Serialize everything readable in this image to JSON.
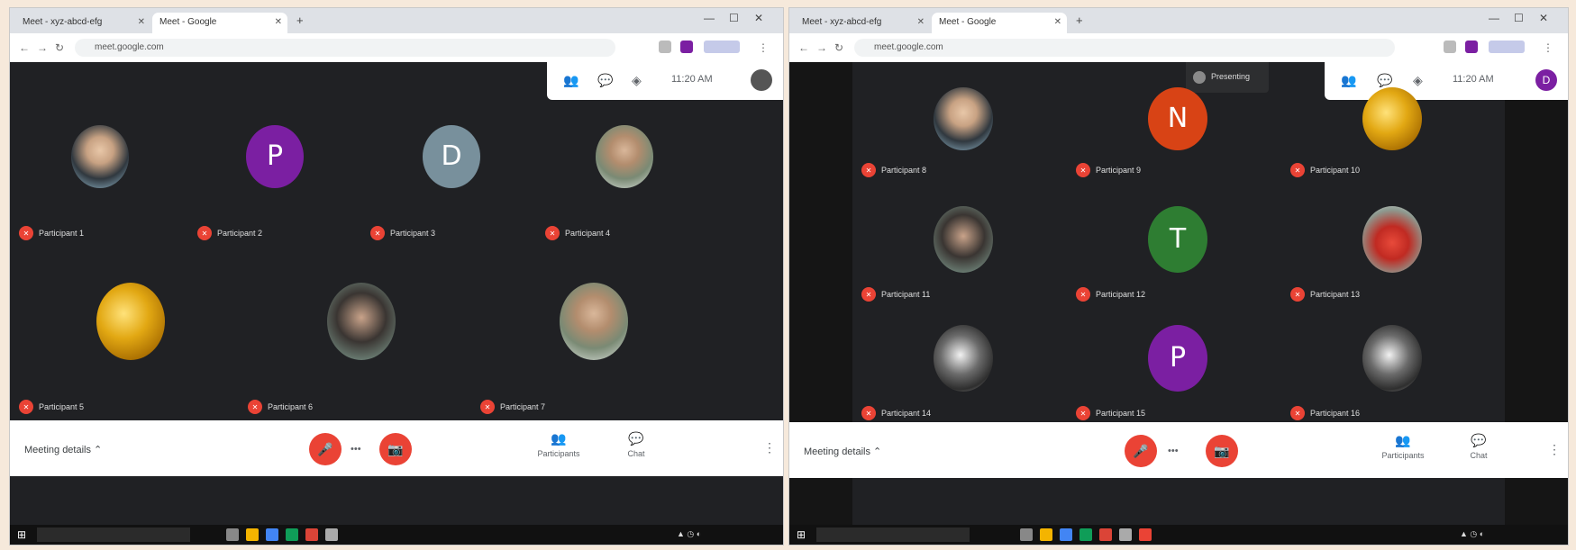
{
  "left": {
    "tabs": [
      {
        "label": "Meet - xyz-abcd-efg"
      },
      {
        "label": "Meet - Google"
      }
    ],
    "url": "meet.google.com",
    "time": "11:20 AM",
    "me_initial": "",
    "tiles": [
      {
        "initial": "",
        "name": "Participant 1"
      },
      {
        "initial": "P",
        "name": "Participant 2"
      },
      {
        "initial": "D",
        "name": "Participant 3"
      },
      {
        "initial": "",
        "name": "Participant 4"
      },
      {
        "initial": "",
        "name": "Participant 5"
      },
      {
        "initial": "",
        "name": "Participant 6"
      },
      {
        "initial": "",
        "name": "Participant 7"
      }
    ],
    "meeting_name": "Meeting details",
    "bottom_buttons": [
      {
        "label": "Participants",
        "icon": "people-icon"
      },
      {
        "label": "Chat",
        "icon": "chat-icon"
      }
    ]
  },
  "right": {
    "tabs": [
      {
        "label": "Meet - xyz-abcd-efg"
      },
      {
        "label": "Meet - Google"
      }
    ],
    "url": "meet.google.com",
    "time": "11:20 AM",
    "me_initial": "D",
    "presenting_label": "Presenting",
    "tiles": [
      {
        "initial": "",
        "name": "Participant 8"
      },
      {
        "initial": "N",
        "name": "Participant 9"
      },
      {
        "initial": "",
        "name": "Participant 10"
      },
      {
        "initial": "",
        "name": "Participant 11"
      },
      {
        "initial": "T",
        "name": "Participant 12"
      },
      {
        "initial": "",
        "name": "Participant 13"
      },
      {
        "initial": "",
        "name": "Participant 14"
      },
      {
        "initial": "P",
        "name": "Participant 15"
      },
      {
        "initial": "",
        "name": "Participant 16"
      }
    ],
    "meeting_name": "Meeting details",
    "bottom_buttons": [
      {
        "label": "Participants",
        "icon": "people-icon"
      },
      {
        "label": "Chat",
        "icon": "chat-icon"
      }
    ]
  },
  "colors": {
    "mic_red": "#ea4335",
    "meet_bg": "#202124",
    "purple": "#7b1fa2",
    "orange": "#d84315",
    "green": "#2e7d32",
    "grey_avatar": "#78909c"
  }
}
